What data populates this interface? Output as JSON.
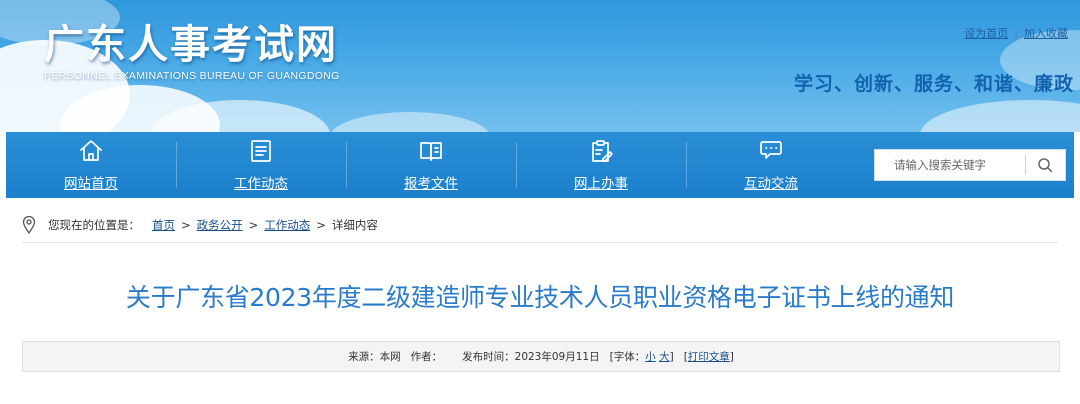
{
  "header": {
    "title": "广东人事考试网",
    "subtitle": "PERSONNEL EXAMINATIONS BUREAU OF GUANGDONG",
    "links": {
      "homepage": "设为首页",
      "separator": "|",
      "favorite": "加入收藏"
    },
    "slogan": "学习、创新、服务、和谐、廉政"
  },
  "nav": {
    "items": [
      {
        "label": "网站首页",
        "icon": "home-icon"
      },
      {
        "label": "工作动态",
        "icon": "news-icon"
      },
      {
        "label": "报考文件",
        "icon": "book-icon"
      },
      {
        "label": "网上办事",
        "icon": "clipboard-edit-icon"
      },
      {
        "label": "互动交流",
        "icon": "chat-icon"
      }
    ],
    "search": {
      "placeholder": "请输入搜索关键字",
      "icon": "search-icon"
    }
  },
  "breadcrumb": {
    "prefix": "您现在的位置是：",
    "items": [
      "首页",
      "政务公开",
      "工作动态",
      "详细内容"
    ],
    "separator": ">",
    "icon": "location-pin-icon"
  },
  "article": {
    "title": "关于广东省2023年度二级建造师专业技术人员职业资格电子证书上线的通知",
    "meta": {
      "source_label": "来源：",
      "source": "本网",
      "author_label": "作者：",
      "author": "",
      "date_label": "发布时间：",
      "date": "2023年09月11日",
      "font_label": "[字体：",
      "font_small": "小",
      "font_large": "大",
      "font_close": "]",
      "print_open": "[",
      "print": "打印文章",
      "print_close": "]"
    }
  },
  "colors": {
    "header_top": "#2f97dc",
    "nav_bg": "#1b7fcc",
    "slogan": "#1262ad",
    "title": "#2a7bc9",
    "link": "#1a4f8a"
  }
}
